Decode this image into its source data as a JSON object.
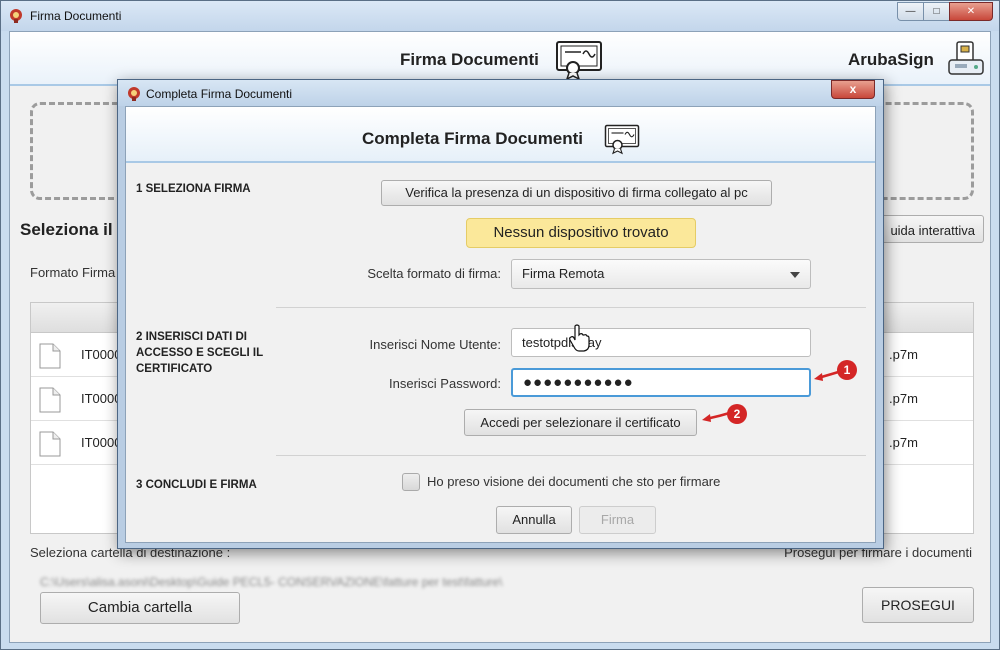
{
  "main_window": {
    "title": "Firma Documenti",
    "header_title": "Firma Documenti",
    "brand": "ArubaSign",
    "select_heading": "Seleziona il",
    "guide_button": "uida interattiva",
    "format_label": "Formato Firma",
    "documents": [
      {
        "name": "IT0000",
        "ext": ".p7m"
      },
      {
        "name": "IT0000",
        "ext": ".p7m"
      },
      {
        "name": "IT0000",
        "ext": ".p7m"
      }
    ],
    "destination_label": "Seleziona cartella di destinazione :",
    "next_label": "Prosegui per firmare i documenti",
    "path_text": "C:\\Users\\alisa.asoni\\Desktop\\Guide PECL5- CONSERVAZIONE\\fatture per test\\fatture\\",
    "change_folder_button": "Cambia cartella",
    "proceed_button": "PROSEGUI"
  },
  "dialog": {
    "title": "Completa Firma Documenti",
    "header_title": "Completa Firma Documenti",
    "close_glyph": "x",
    "steps": {
      "step1": "1 SELEZIONA FIRMA",
      "step2": "2 INSERISCI DATI DI ACCESSO E SCEGLI IL CERTIFICATO",
      "step3": "3 CONCLUDI E FIRMA"
    },
    "verify_button": "Verifica la presenza di un dispositivo di firma collegato al pc",
    "no_device_text": "Nessun dispositivo trovato",
    "format_label": "Scelta formato di firma:",
    "format_selected": "Firma Remota",
    "username_label": "Inserisci Nome Utente:",
    "username_value": "testotpdisplay",
    "password_label": "Inserisci Password:",
    "password_value": "●●●●●●●●●●●",
    "access_button": "Accedi per selezionare il certificato",
    "checkbox_label": "Ho preso visione dei documenti che sto per firmare",
    "cancel_button": "Annulla",
    "sign_button": "Firma"
  },
  "annotations": {
    "badge1": "1",
    "badge2": "2",
    "color": "#d42626"
  },
  "icons": [
    "app-icon",
    "certificate-icon",
    "smartcard-reader-icon",
    "file-icon",
    "hand-cursor-icon"
  ]
}
